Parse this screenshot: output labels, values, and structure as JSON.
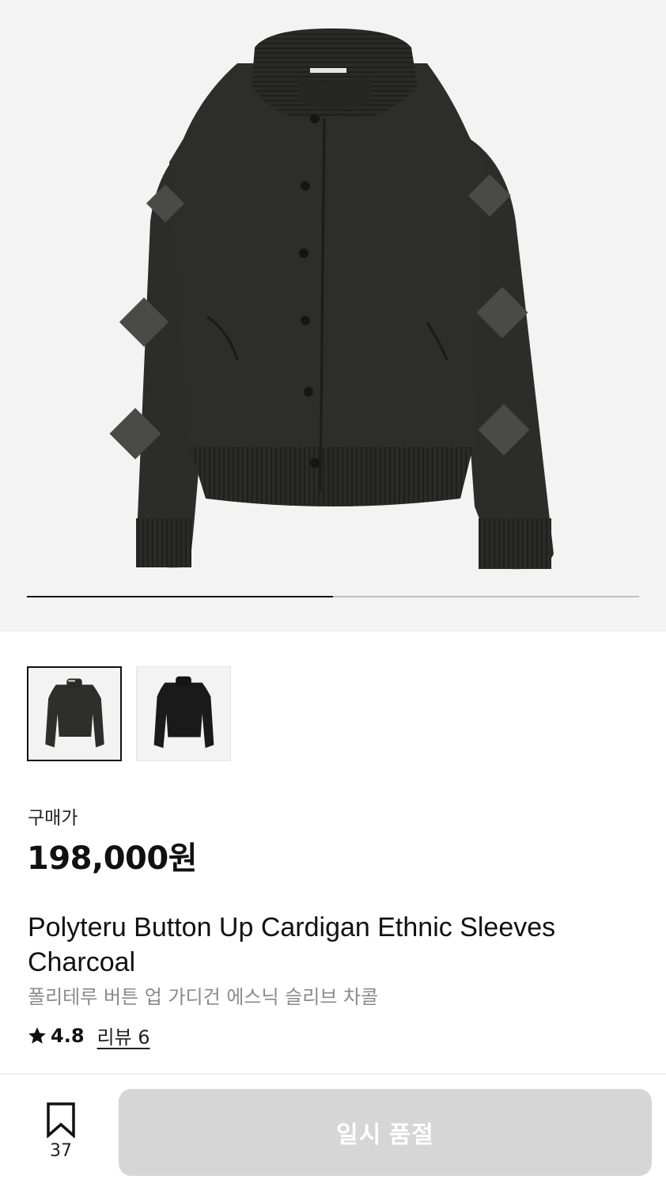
{
  "gallery": {
    "current_index": 1,
    "total": 2,
    "progress_fraction": 0.5,
    "selected_thumbnail": 0,
    "thumbnail_count": 2
  },
  "price": {
    "label": "구매가",
    "value": "198,000원"
  },
  "product": {
    "name_en": "Polyteru Button Up Cardigan Ethnic Sleeves Charcoal",
    "name_ko": "폴리테루 버튼 업 가디건 에스닉 슬리브 차콜"
  },
  "rating": {
    "icon": "star-icon",
    "score": "4.8",
    "review_link": "리뷰 6"
  },
  "action_bar": {
    "bookmark_icon": "bookmark-icon",
    "bookmark_count": "37",
    "primary_button": "일시 품절"
  },
  "colors": {
    "hero_background": "#f3f3f3",
    "button_disabled": "#d6d6d6",
    "muted_text": "#8a8a8a"
  }
}
